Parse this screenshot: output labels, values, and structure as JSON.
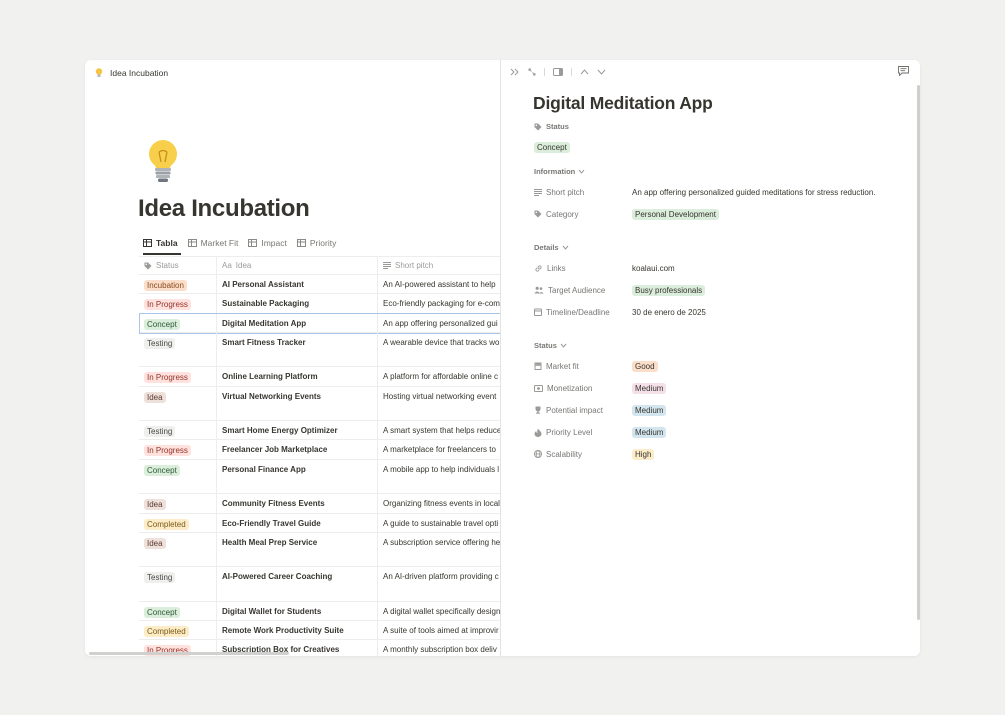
{
  "breadcrumb": {
    "title": "Idea Incubation"
  },
  "page": {
    "title": "Idea Incubation"
  },
  "views": [
    {
      "label": "Tabla",
      "icon": "table-icon"
    },
    {
      "label": "Market Fit",
      "icon": "table-icon"
    },
    {
      "label": "Impact",
      "icon": "table-icon"
    },
    {
      "label": "Priority",
      "icon": "table-icon"
    }
  ],
  "columns": {
    "status": "Status",
    "idea_prefix": "Aa",
    "idea": "Idea",
    "pitch": "Short pitch"
  },
  "rows": [
    {
      "status": "Incubation",
      "idea": "AI Personal Assistant",
      "pitch": "An AI-powered assistant to help",
      "tall": false
    },
    {
      "status": "In Progress",
      "idea": "Sustainable Packaging",
      "pitch": "Eco-friendly packaging for e-com",
      "tall": false
    },
    {
      "status": "Concept",
      "idea": "Digital Meditation App",
      "pitch": "An app offering personalized gui",
      "tall": false,
      "selected": true
    },
    {
      "status": "Testing",
      "idea": "Smart Fitness Tracker",
      "pitch": "A wearable device that tracks wo",
      "tall": true
    },
    {
      "status": "In Progress",
      "idea": "Online Learning Platform",
      "pitch": "A platform for affordable online c",
      "tall": false
    },
    {
      "status": "Idea",
      "idea": "Virtual Networking Events",
      "pitch": "Hosting virtual networking event",
      "tall": true
    },
    {
      "status": "Testing",
      "idea": "Smart Home Energy Optimizer",
      "pitch": "A smart system that helps reduce",
      "tall": false
    },
    {
      "status": "In Progress",
      "idea": "Freelancer Job Marketplace",
      "pitch": "A marketplace for freelancers to",
      "tall": false
    },
    {
      "status": "Concept",
      "idea": "Personal Finance App",
      "pitch": "A mobile app to help individuals l",
      "tall": true
    },
    {
      "status": "Idea",
      "idea": "Community Fitness Events",
      "pitch": "Organizing fitness events in local",
      "tall": false
    },
    {
      "status": "Completed",
      "idea": "Eco-Friendly Travel Guide",
      "pitch": "A guide to sustainable travel opti",
      "tall": false
    },
    {
      "status": "Idea",
      "idea": "Health Meal Prep Service",
      "pitch": "A subscription service offering he",
      "tall": true
    },
    {
      "status": "Testing",
      "idea": "AI-Powered Career Coaching",
      "pitch": "An AI-driven platform providing c",
      "tall": true
    },
    {
      "status": "Concept",
      "idea": "Digital Wallet for Students",
      "pitch": "A digital wallet specifically design",
      "tall": false
    },
    {
      "status": "Completed",
      "idea": "Remote Work Productivity Suite",
      "pitch": "A suite of tools aimed at improvir",
      "tall": false
    },
    {
      "status": "In Progress",
      "idea": "Subscription Box for Creatives",
      "pitch": "A monthly subscription box deliv",
      "tall": false
    }
  ],
  "status_colors": {
    "Incubation": {
      "bg": "#fadec9",
      "fg": "#8a4a1f"
    },
    "In Progress": {
      "bg": "#ffe2dd",
      "fg": "#93332b"
    },
    "Concept": {
      "bg": "#dbeddb",
      "fg": "#2b5a36"
    },
    "Testing": {
      "bg": "#efefed",
      "fg": "#4b4a46"
    },
    "Idea": {
      "bg": "#eee0da",
      "fg": "#5c3b30"
    },
    "Completed": {
      "bg": "#fdecc8",
      "fg": "#7a5a16"
    }
  },
  "detail": {
    "title": "Digital Meditation App",
    "status_label": "Status",
    "status_value": "Concept",
    "information_section": "Information",
    "short_pitch_label": "Short pitch",
    "short_pitch_value": "An app offering personalized guided meditations for stress reduction.",
    "category_label": "Category",
    "category_value": "Personal Development",
    "details_section": "Details",
    "links_label": "Links",
    "links_value": "koalaui.com",
    "audience_label": "Target Audience",
    "audience_value": "Busy professionals",
    "timeline_label": "Timeline/Deadline",
    "timeline_value": "30 de enero de 2025",
    "status_section": "Status",
    "market_fit_label": "Market fit",
    "market_fit_value": "Good",
    "monetization_label": "Monetization",
    "monetization_value": "Medium",
    "impact_label": "Potential impact",
    "impact_value": "Medium",
    "priority_label": "Priority Level",
    "priority_value": "Medium",
    "scalability_label": "Scalability",
    "scalability_value": "High"
  },
  "detail_colors": {
    "concept": "#dbeddb",
    "category": "#dbeddb",
    "audience": "#dbeddb",
    "good": "#fadec9",
    "monetization": "#f5e0e9",
    "impact": "#d3e5ef",
    "priority": "#d3e5ef",
    "high": "#fdecc8"
  }
}
